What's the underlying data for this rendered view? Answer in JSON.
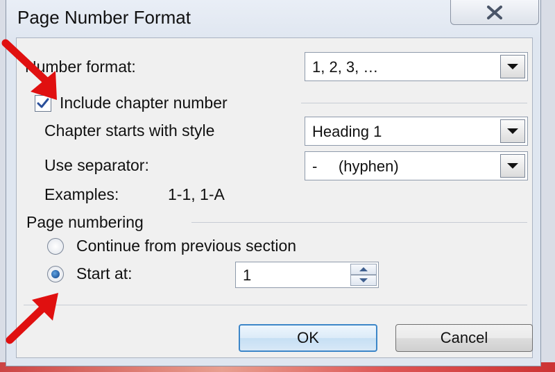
{
  "dialog": {
    "title": "Page Number Format",
    "close_icon": "close-icon"
  },
  "number_format": {
    "label": "Number format:",
    "value": "1, 2, 3, …"
  },
  "include_chapter": {
    "label": "Include chapter number",
    "checked": true
  },
  "chapter_style": {
    "label": "Chapter starts with style",
    "value": "Heading 1"
  },
  "separator": {
    "label": "Use separator:",
    "value": "-     (hyphen)"
  },
  "examples": {
    "label": "Examples:",
    "value": "1-1, 1-A"
  },
  "page_numbering": {
    "group_label": "Page numbering",
    "continue_label": "Continue from previous section",
    "start_at_label": "Start at:",
    "start_at_value": "1",
    "selected": "start_at"
  },
  "buttons": {
    "ok": "OK",
    "cancel": "Cancel"
  },
  "annotation_color": "#e01010"
}
